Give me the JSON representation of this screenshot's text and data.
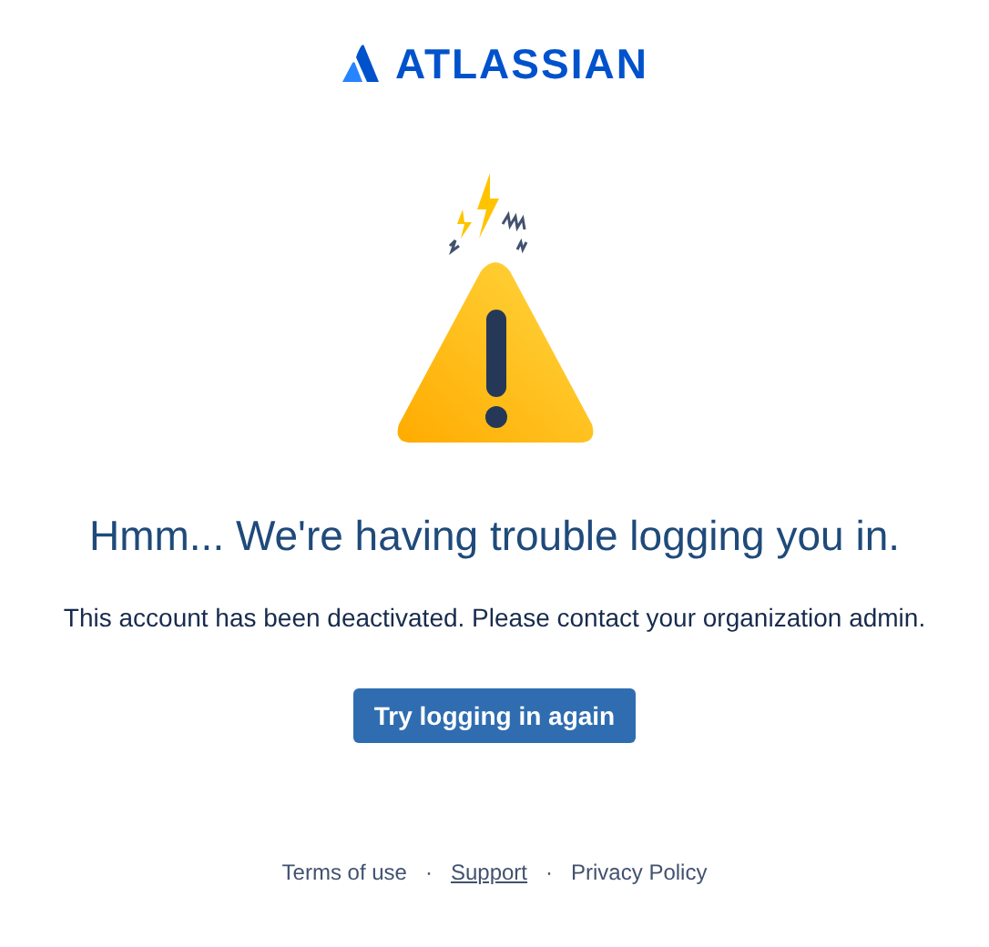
{
  "logo": {
    "wordmark": "ATLASSIAN"
  },
  "heading": "Hmm... We're having trouble logging you in.",
  "message": "This account has been deactivated. Please contact your organization admin.",
  "button": {
    "label": "Try logging in again"
  },
  "footer": {
    "separator": "·",
    "links": [
      {
        "label": "Terms of use",
        "underlined": false
      },
      {
        "label": "Support",
        "underlined": true
      },
      {
        "label": "Privacy Policy",
        "underlined": false
      }
    ]
  }
}
